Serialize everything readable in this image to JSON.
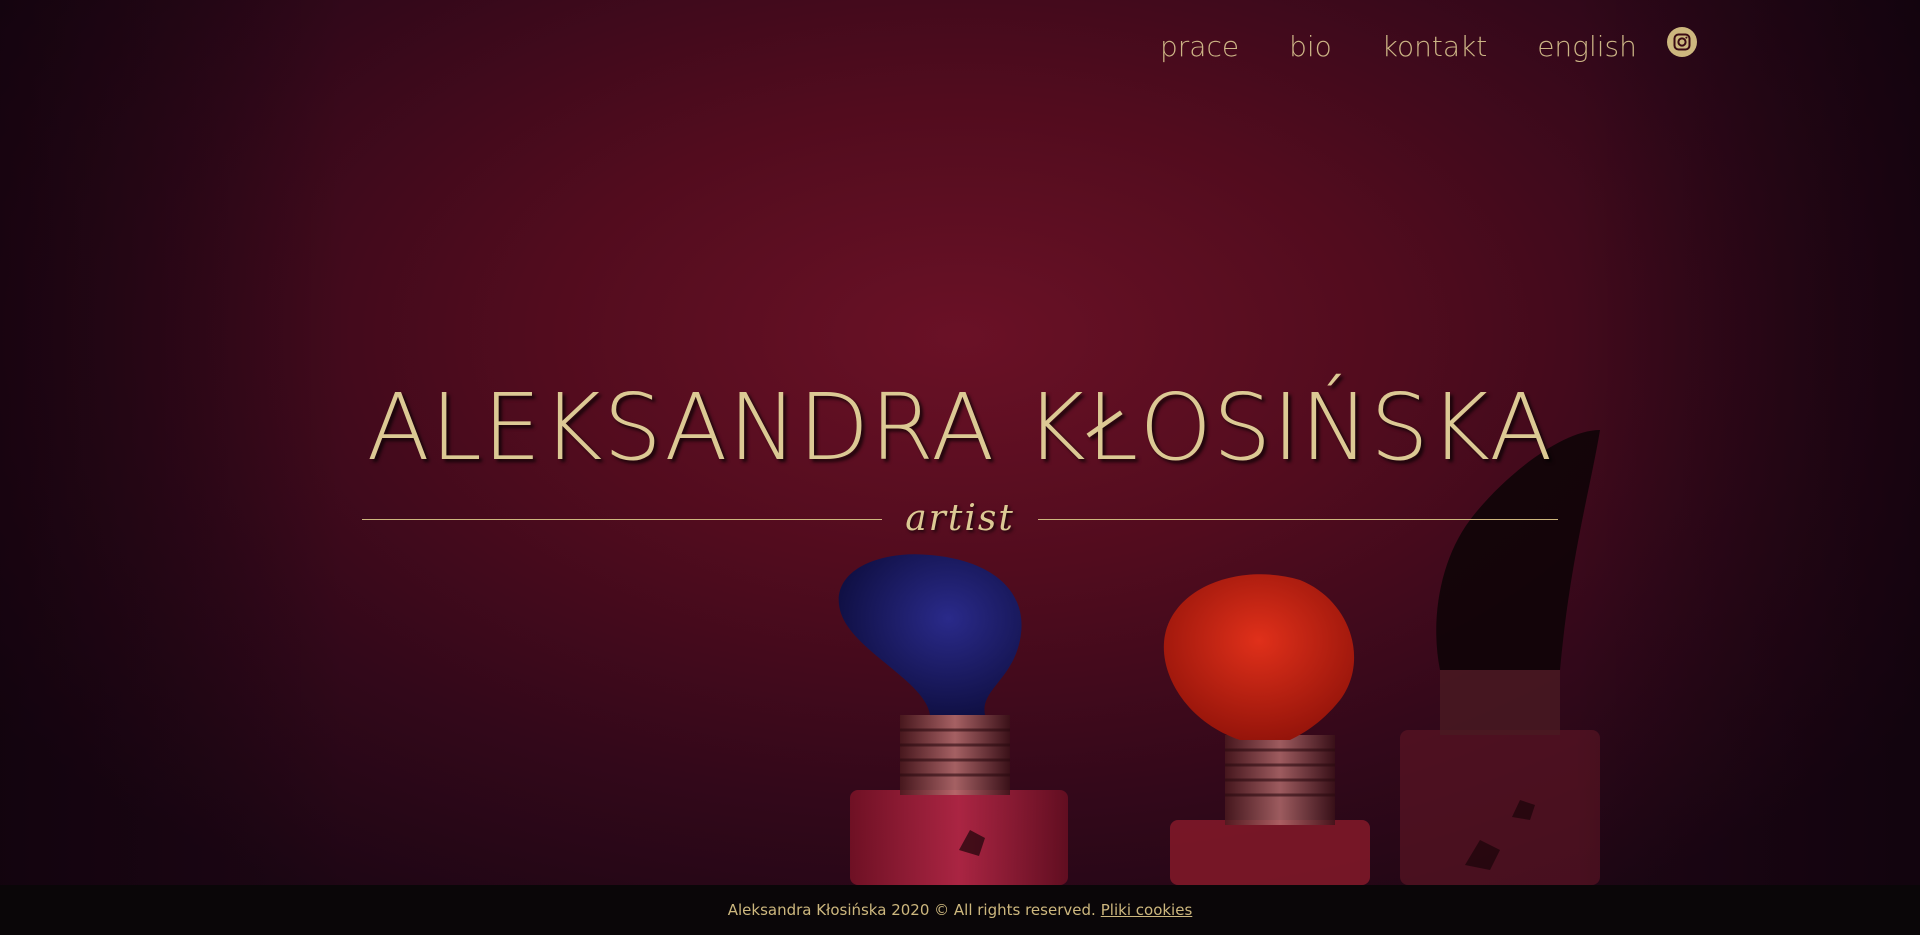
{
  "nav": {
    "items": [
      {
        "label": "prace"
      },
      {
        "label": "bio"
      },
      {
        "label": "kontakt"
      },
      {
        "label": "english"
      }
    ],
    "social_icon": "instagram-icon"
  },
  "hero": {
    "title": "ALEKSANDRA KŁOSIŃSKA",
    "subtitle": "artist"
  },
  "footer": {
    "copyright": "Aleksandra Kłosińska 2020 © All rights reserved.",
    "cookies_link": "Pliki cookies"
  },
  "colors": {
    "accent_gold": "#dcc994",
    "background_crimson": "#520c1e",
    "footer_bg": "#0a0608"
  }
}
